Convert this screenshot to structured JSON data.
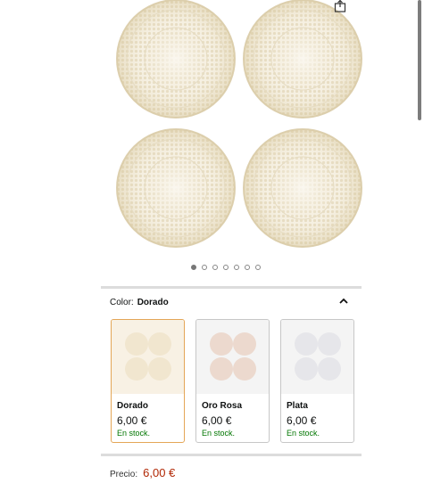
{
  "colors": {
    "accent_selected": "#e4a657",
    "price": "#b12704",
    "stock": "#007600"
  },
  "gallery": {
    "dots_total": 7,
    "active_index": 0,
    "share_icon": "share-icon"
  },
  "variation": {
    "label": "Color:",
    "selected": "Dorado",
    "options": [
      {
        "name": "Dorado",
        "price": "6,00 €",
        "stock": "En stock.",
        "selected": true,
        "tint": "#f1e6cf"
      },
      {
        "name": "Oro Rosa",
        "price": "6,00 €",
        "stock": "En stock.",
        "selected": false,
        "tint": "#ecd9ce"
      },
      {
        "name": "Plata",
        "price": "6,00 €",
        "stock": "En stock.",
        "selected": false,
        "tint": "#e9e9ec"
      }
    ]
  },
  "price": {
    "label": "Precio:",
    "value": "6,00 €"
  }
}
